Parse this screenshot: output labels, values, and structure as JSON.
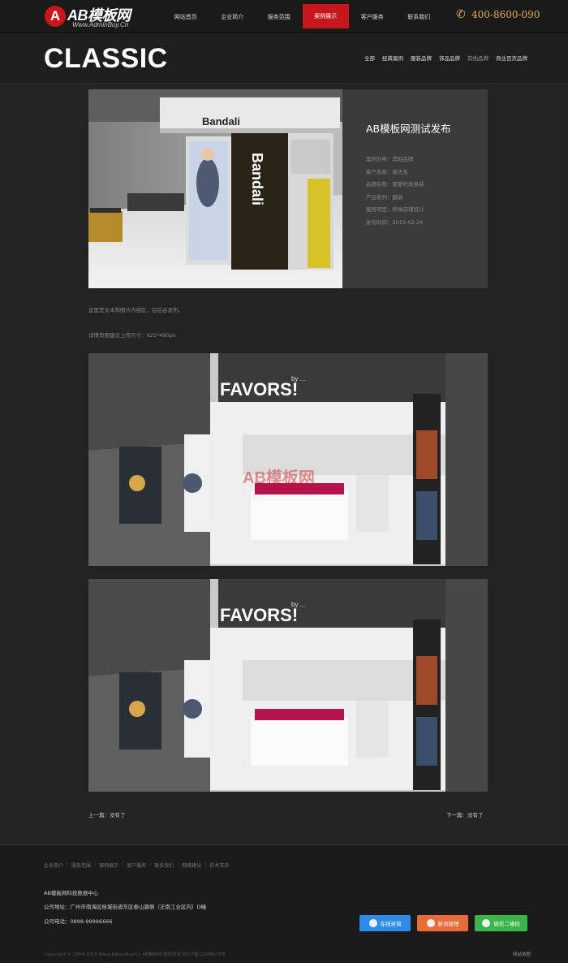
{
  "brand": {
    "logo_letter": "A",
    "logo_text": "AB模板网",
    "logo_sub": "Www.AdminBuy.Cn"
  },
  "nav": {
    "items": [
      "网站首页",
      "企业简介",
      "服务范围",
      "案例展示",
      "客户服务",
      "联系我们"
    ],
    "active": "案例展示"
  },
  "phone": "400-8600-090",
  "page": {
    "title": "CLASSIC"
  },
  "categories": [
    "全部",
    "经典案例",
    "服装品牌",
    "饰品品牌",
    "其他品牌",
    "商业百货品牌"
  ],
  "case": {
    "title": "AB模板网测试发布",
    "meta": [
      "案例分类：其他品牌",
      "客户名称：聚先生",
      "品牌名称：聚蒙时尚男装",
      "产品系列：服装",
      "服务项目：终端店铺设计",
      "发布时间：2015-02-24"
    ],
    "brand_sign": "Bandali"
  },
  "content": {
    "line1": "这里是文本和图片内容区，在后台发布。",
    "line2": "详情页图建议上传尺寸：625*490px",
    "store_sign": "FAVORS!",
    "store_sign_small": "by ...",
    "watermark": "AB模板网"
  },
  "pager": {
    "prev": "上一篇：没有了",
    "next": "下一篇：没有了"
  },
  "footer": {
    "links": [
      "企业简介",
      "服务范围",
      "案例展示",
      "客户服务",
      "联系我们",
      "网络建设",
      "技术支持"
    ],
    "company_name": "AB模板网科技数据中心",
    "address": "公司地址：广州市南海区桂城街道东区泰山路侧（正南工业区内）D幢",
    "tel": "公司电话：0898-99996666",
    "share": [
      "在线咨询",
      "新浪微博",
      "微信二维码"
    ],
    "copyright": "Copyright © 2004-2015 Www.AdminBuy.Cn AB模板网 版权所有 桂ICP备12345678号",
    "sitemap": "网站地图"
  },
  "colors": {
    "accent": "#c8161d",
    "phone": "#e3b04b",
    "qq": "#2f8be8",
    "weibo": "#e86b3a",
    "wechat": "#3bb54a"
  }
}
